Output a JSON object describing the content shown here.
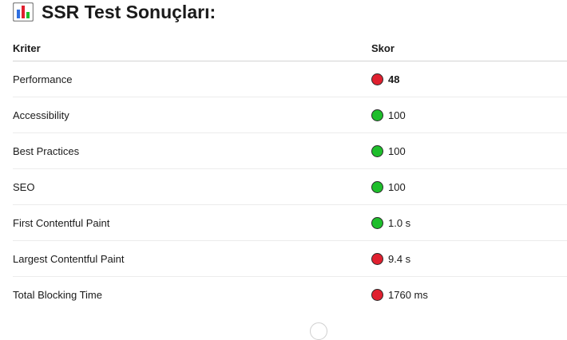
{
  "heading": {
    "icon": "bar-chart-icon",
    "title": "SSR Test Sonuçları:"
  },
  "table": {
    "headers": {
      "criterion": "Kriter",
      "score": "Skor"
    },
    "rows": [
      {
        "criterion": "Performance",
        "score": "48",
        "status": "red",
        "emphasis": true
      },
      {
        "criterion": "Accessibility",
        "score": "100",
        "status": "green",
        "emphasis": false
      },
      {
        "criterion": "Best Practices",
        "score": "100",
        "status": "green",
        "emphasis": false
      },
      {
        "criterion": "SEO",
        "score": "100",
        "status": "green",
        "emphasis": false
      },
      {
        "criterion": "First Contentful Paint",
        "score": "1.0 s",
        "status": "green",
        "emphasis": false
      },
      {
        "criterion": "Largest Contentful Paint",
        "score": "9.4 s",
        "status": "red",
        "emphasis": false
      },
      {
        "criterion": "Total Blocking Time",
        "score": "1760 ms",
        "status": "red",
        "emphasis": false
      }
    ]
  },
  "colors": {
    "red": "#e0202f",
    "green": "#1ebe2b"
  }
}
